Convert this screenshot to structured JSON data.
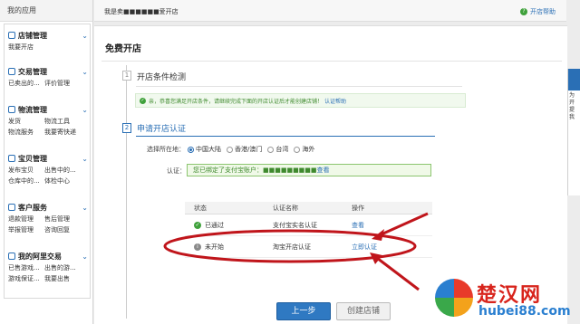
{
  "sidebar": {
    "header": "我的应用",
    "groups": [
      {
        "title": "店铺管理",
        "icon": "store-icon",
        "links": [
          "我要开店"
        ]
      },
      {
        "title": "交易管理",
        "icon": "trade-icon",
        "links": [
          "已卖出的...",
          "评价管理"
        ]
      },
      {
        "title": "物流管理",
        "icon": "logistics-icon",
        "links": [
          "发货",
          "物流工具",
          "物流服务",
          "我要寄快递"
        ]
      },
      {
        "title": "宝贝管理",
        "icon": "goods-icon",
        "links": [
          "发布宝贝",
          "出售中的...",
          "仓库中的...",
          "体检中心"
        ]
      },
      {
        "title": "客户服务",
        "icon": "service-icon",
        "links": [
          "退款管理",
          "售后管理",
          "举报管理",
          "咨询回复"
        ]
      },
      {
        "title": "我的阿里交易",
        "icon": "ali-icon",
        "links": [
          "已售游戏...",
          "出售的游...",
          "游戏保证...",
          "我要出售"
        ]
      }
    ]
  },
  "topbar": {
    "left_text": "我是卖■■■■■■爱开店",
    "help_label": "开店帮助"
  },
  "main": {
    "title": "免费开店",
    "step1": {
      "num": "1",
      "title": "开店条件检测",
      "notice": "亲，恭喜您满足开店条件，请继续完成下面的开店认证后才能创建店铺！",
      "notice_link": "认证帮助"
    },
    "step2": {
      "num": "2",
      "title": "申请开店认证",
      "region_label": "选择所在地：",
      "regions": [
        {
          "label": "中国大陆",
          "selected": true
        },
        {
          "label": "香港/澳门",
          "selected": false
        },
        {
          "label": "台湾",
          "selected": false
        },
        {
          "label": "海外",
          "selected": false
        }
      ],
      "auth_label": "认证：",
      "auth_text": "您已绑定了支付宝账户：■■■■■■■■■",
      "auth_link": "查看"
    },
    "table": {
      "headers": [
        "状态",
        "认证名称",
        "操作"
      ],
      "rows": [
        {
          "status": "已通过",
          "name": "支付宝实名认证",
          "action": "查看",
          "ok": true
        },
        {
          "status": "未开始",
          "name": "淘宝开店认证",
          "action": "立即认证",
          "ok": false
        }
      ]
    },
    "buttons": {
      "prev": "上一步",
      "create": "创建店铺"
    }
  },
  "right_panel": {
    "text": "为 开 提 我"
  },
  "watermark": {
    "name": "楚汉网",
    "url": "hubei88.com"
  }
}
